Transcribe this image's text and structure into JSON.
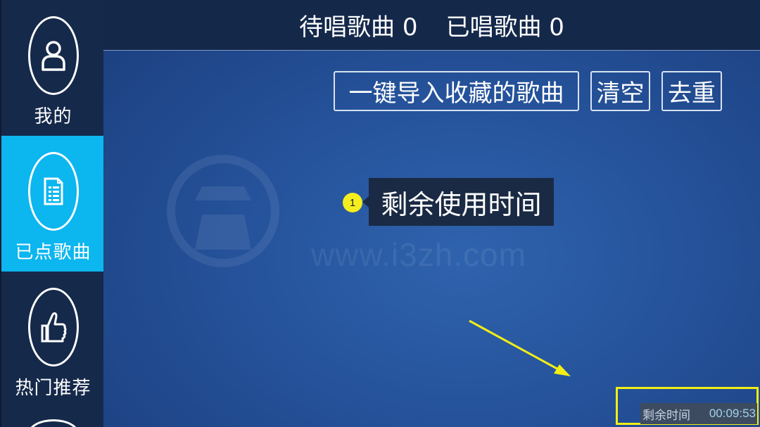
{
  "sidebar": {
    "items": [
      {
        "label": "我的",
        "icon": "user-icon"
      },
      {
        "label": "已点歌曲",
        "icon": "song-list-icon",
        "active": true
      },
      {
        "label": "热门推荐",
        "icon": "thumbs-up-icon"
      }
    ]
  },
  "header": {
    "waiting_label": "待唱歌曲 0",
    "sung_label": "已唱歌曲 0"
  },
  "toolbar": {
    "import_label": "一键导入收藏的歌曲",
    "clear_label": "清空",
    "dedupe_label": "去重"
  },
  "watermark": {
    "text": "www.i3zh.com"
  },
  "annotation": {
    "marker": "1",
    "tooltip": "剩余使用时间"
  },
  "status": {
    "remaining_label": "剩余时间",
    "remaining_time": "00:09:53"
  },
  "colors": {
    "accent": "#0cb6ef",
    "highlight": "#f3ee15",
    "sidebar_bg": "#15294a"
  }
}
